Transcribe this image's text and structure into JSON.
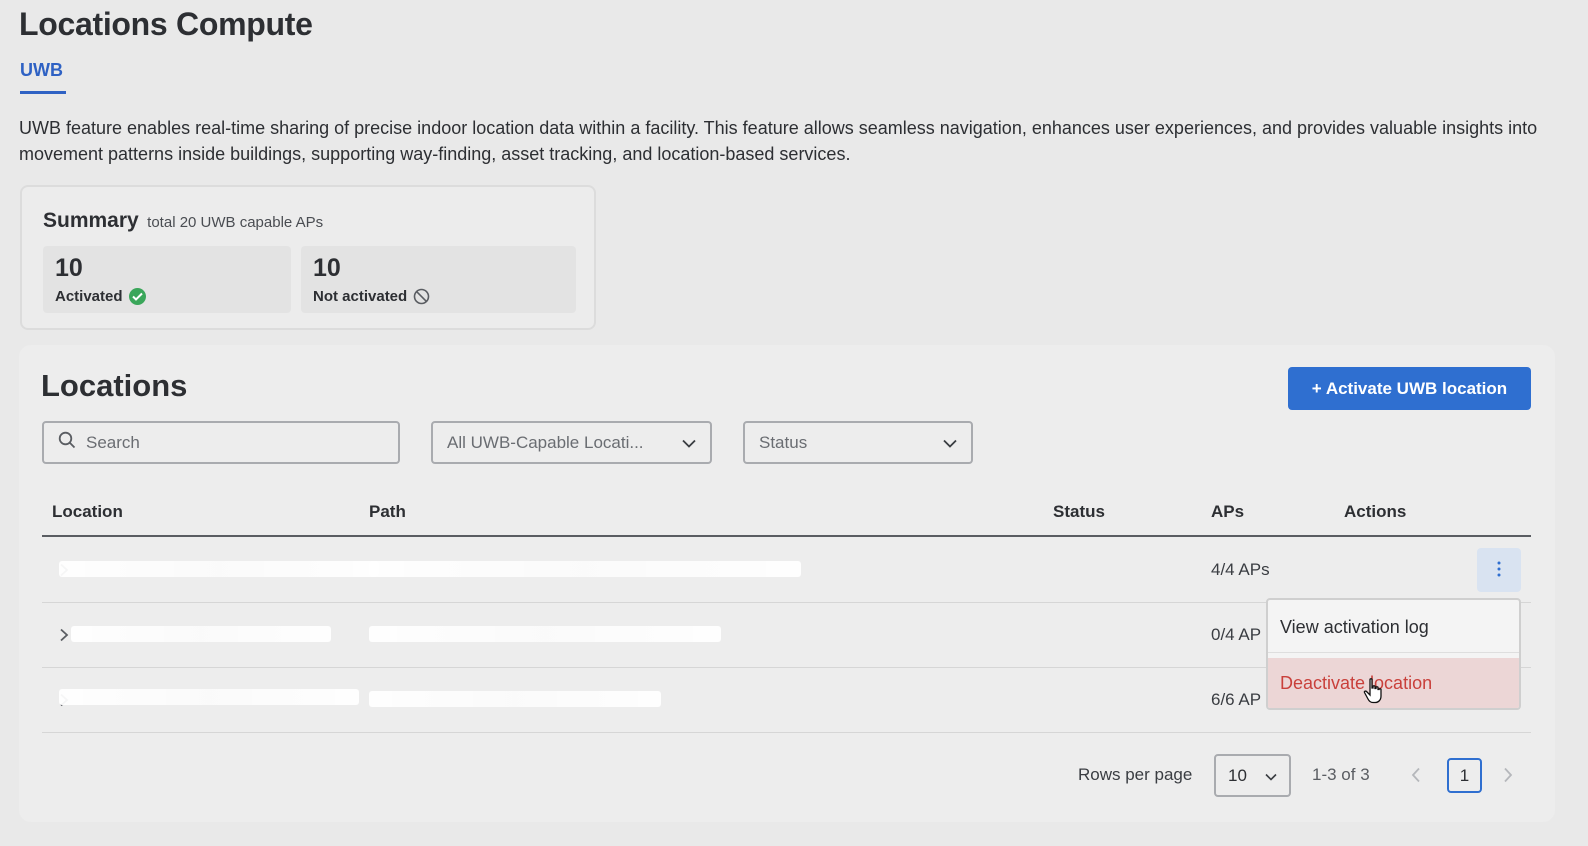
{
  "page": {
    "title": "Locations Compute",
    "tab": "UWB",
    "description": "UWB feature enables real-time sharing of precise indoor location data within a facility. This feature allows seamless navigation, enhances user experiences, and provides valuable insights into movement patterns inside buildings, supporting way-finding, asset tracking, and location-based services."
  },
  "summary": {
    "title": "Summary",
    "subtitle": "total 20 UWB capable APs",
    "activated": {
      "count": "10",
      "label": "Activated",
      "icon": "check-circle-icon",
      "color": "#3aa65a"
    },
    "not_activated": {
      "count": "10",
      "label": "Not activated",
      "icon": "ban-icon"
    }
  },
  "locations": {
    "title": "Locations",
    "activate_button": "+ Activate UWB location",
    "search_placeholder": "Search",
    "location_filter": "All UWB-Capable Locati...",
    "status_filter": "Status",
    "columns": {
      "location": "Location",
      "path": "Path",
      "status": "Status",
      "aps": "APs",
      "actions": "Actions"
    },
    "rows": [
      {
        "aps": "4/4 APs"
      },
      {
        "aps": "0/4 AP"
      },
      {
        "aps": "6/6 AP"
      }
    ],
    "menu": {
      "view_log": "View activation log",
      "deactivate": "Deactivate location"
    },
    "pagination": {
      "rows_label": "Rows per page",
      "rows_value": "10",
      "range": "1-3 of 3",
      "page": "1"
    }
  },
  "colors": {
    "accent": "#2f6fd0",
    "danger": "#c9403b"
  }
}
